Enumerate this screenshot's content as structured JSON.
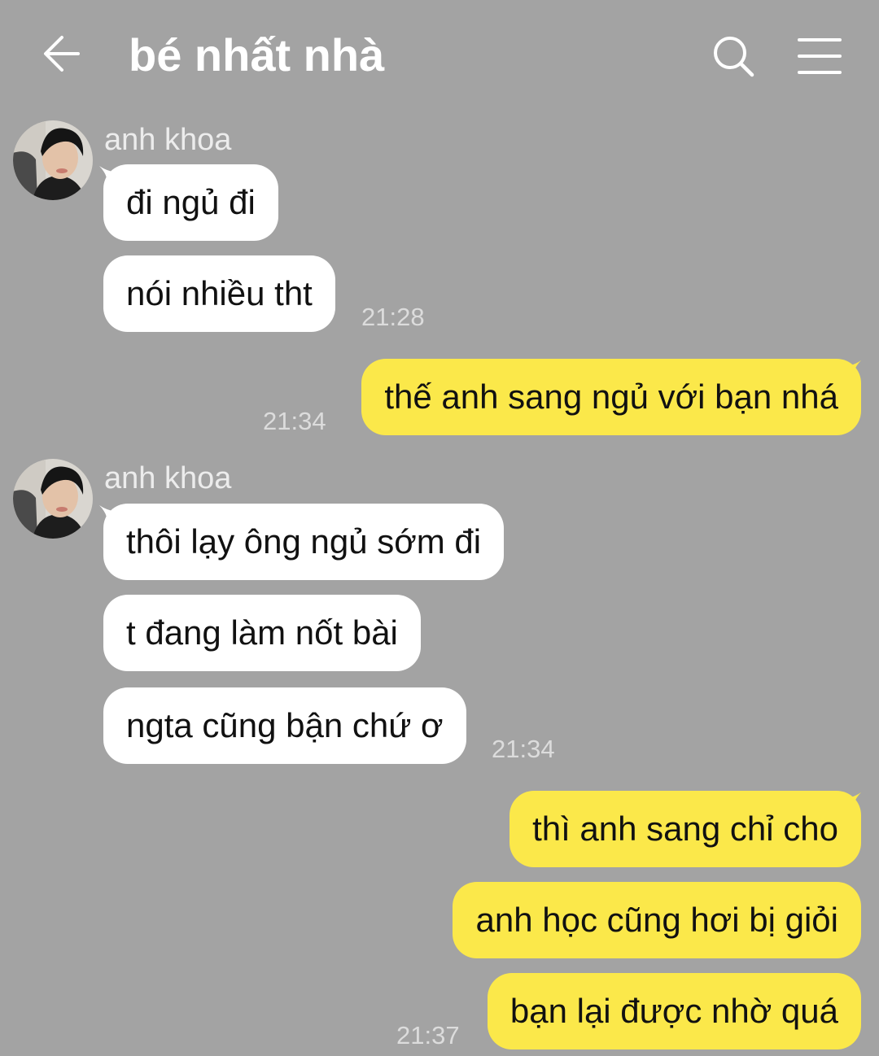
{
  "header": {
    "title": "bé nhất nhà",
    "back_icon": "arrow-left-icon",
    "search_icon": "search-icon",
    "menu_icon": "hamburger-menu-icon"
  },
  "colors": {
    "background": "#a3a3a3",
    "incoming_bubble": "#ffffff",
    "outgoing_bubble": "#fbe84a",
    "text": "#111111"
  },
  "messages": {
    "group1": {
      "sender": "anh khoa",
      "m1": "đi ngủ đi",
      "m2": "nói nhiều tht",
      "time": "21:28"
    },
    "out1": {
      "m1": "thế anh sang ngủ với bạn nhá",
      "time": "21:34"
    },
    "group2": {
      "sender": "anh khoa",
      "m1": "thôi lạy ông ngủ sớm đi",
      "m2": "t đang làm nốt bài",
      "m3": "ngta cũng bận chứ ơ",
      "time": "21:34"
    },
    "out2": {
      "m1": "thì anh sang chỉ cho",
      "m2": "anh học cũng hơi bị giỏi",
      "m3": "bạn lại được nhờ quá",
      "time": "21:37"
    }
  }
}
